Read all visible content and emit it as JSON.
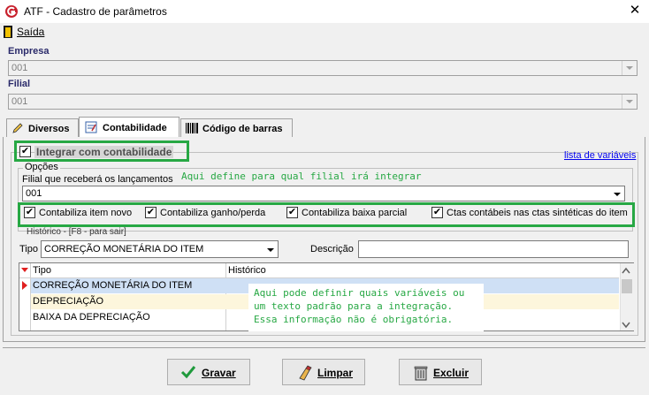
{
  "window": {
    "title": "ATF - Cadastro de parâmetros",
    "close_glyph": "✕"
  },
  "menu": {
    "saida": "Saída"
  },
  "empresa": {
    "label": "Empresa",
    "value": "001"
  },
  "filial": {
    "label": "Filial",
    "value": "001"
  },
  "tabs": [
    {
      "label": "Diversos",
      "icon": "edit-pencil-icon"
    },
    {
      "label": "Contabilidade",
      "icon": "ledger-icon"
    },
    {
      "label": "Código de barras",
      "icon": "barcode-icon"
    }
  ],
  "contabilidade": {
    "integrar_label": "Integrar com contabilidade",
    "integrar_checked": true,
    "lista_variaveis": "lista de variáveis",
    "opcoes_label": "Opções",
    "filial_lancamentos_label": "Filial que receberá os lançamentos",
    "filial_lancamentos_value": "001",
    "annotation_filial": "Aqui define para qual filial irá integrar",
    "checks": [
      {
        "label": "Contabiliza item novo",
        "checked": true
      },
      {
        "label": "Contabiliza ganho/perda",
        "checked": true
      },
      {
        "label": "Contabiliza baixa parcial",
        "checked": true
      },
      {
        "label": "Ctas contábeis nas ctas sintéticas do item",
        "checked": true
      }
    ],
    "historico_label": "Histórico - [F8 - para sair]",
    "tipo_label": "Tipo",
    "tipo_value": "CORREÇÃO MONETÁRIA DO ITEM",
    "descricao_label": "Descrição",
    "descricao_value": "",
    "grid": {
      "headers": [
        "Tipo",
        "Histórico"
      ],
      "rows": [
        {
          "tipo": "CORREÇÃO MONETÁRIA DO ITEM",
          "historico": ""
        },
        {
          "tipo": "DEPRECIAÇÃO",
          "historico": ""
        },
        {
          "tipo": "BAIXA DA DEPRECIAÇÃO",
          "historico": ""
        }
      ]
    },
    "annotation_historico": [
      "Aqui pode definir quais variáveis ou",
      "um texto padrão para a integração.",
      "Essa informação não é obrigatória."
    ]
  },
  "buttons": {
    "gravar": "Gravar",
    "limpar": "Limpar",
    "excluir": "Excluir"
  },
  "colors": {
    "annotation_green": "#27a844",
    "row_selected": "#cfe0f5",
    "row_alt": "#fdf6dc"
  }
}
